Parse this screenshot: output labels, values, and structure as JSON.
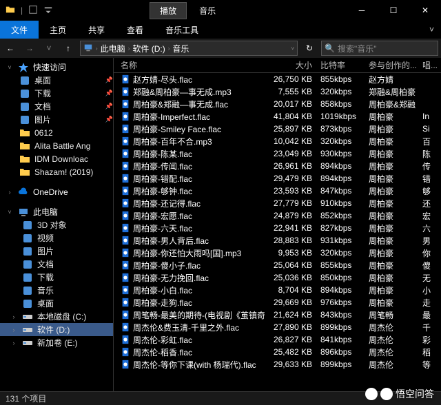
{
  "title_group": {
    "box": "播放",
    "plain": "音乐"
  },
  "ribbon": {
    "file": "文件",
    "tabs": [
      "主页",
      "共享",
      "查看",
      "音乐工具"
    ]
  },
  "breadcrumb": [
    "此电脑",
    "软件 (D:)",
    "音乐"
  ],
  "search_placeholder": "搜索\"音乐\"",
  "columns": {
    "name": "名称",
    "size": "大小",
    "bitrate": "比特率",
    "artist": "参与创作的...",
    "extra": "唱..."
  },
  "status": "131 个项目",
  "watermark": "悟空问答",
  "sidebar": {
    "quick": {
      "label": "快速访问",
      "items": [
        "桌面",
        "下载",
        "文档",
        "图片",
        "0612",
        "Alita Battle Ang",
        "IDM Downloac",
        "Shazam! (2019)"
      ]
    },
    "onedrive": "OneDrive",
    "pc": {
      "label": "此电脑",
      "items": [
        "3D 对象",
        "视频",
        "图片",
        "文档",
        "下载",
        "音乐",
        "桌面",
        "本地磁盘 (C:)",
        "软件 (D:)",
        "新加卷 (E:)"
      ]
    },
    "selected_index": 8
  },
  "files": [
    {
      "name": "赵方婧-尽头.flac",
      "size": "26,750 KB",
      "bitrate": "855kbps",
      "artist": "赵方婧",
      "extra": ""
    },
    {
      "name": "郑融&周柏豪—事无成.mp3",
      "size": "7,555 KB",
      "bitrate": "320kbps",
      "artist": "郑融&周柏豪",
      "extra": ""
    },
    {
      "name": "周柏豪&郑融—事无成.flac",
      "size": "20,017 KB",
      "bitrate": "858kbps",
      "artist": "周柏豪&郑融",
      "extra": ""
    },
    {
      "name": "周柏豪-Imperfect.flac",
      "size": "41,804 KB",
      "bitrate": "1019kbps",
      "artist": "周柏豪",
      "extra": "In"
    },
    {
      "name": "周柏豪-Smiley Face.flac",
      "size": "25,897 KB",
      "bitrate": "873kbps",
      "artist": "周柏豪",
      "extra": "Si"
    },
    {
      "name": "周柏豪-百年不合.mp3",
      "size": "10,042 KB",
      "bitrate": "320kbps",
      "artist": "周柏豪",
      "extra": "百"
    },
    {
      "name": "周柏豪-陈某.flac",
      "size": "23,049 KB",
      "bitrate": "930kbps",
      "artist": "周柏豪",
      "extra": "陈"
    },
    {
      "name": "周柏豪-传闻.flac",
      "size": "26,961 KB",
      "bitrate": "894kbps",
      "artist": "周柏豪",
      "extra": "传"
    },
    {
      "name": "周柏豪-错配.flac",
      "size": "29,479 KB",
      "bitrate": "894kbps",
      "artist": "周柏豪",
      "extra": "错"
    },
    {
      "name": "周柏豪-够钟.flac",
      "size": "23,593 KB",
      "bitrate": "847kbps",
      "artist": "周柏豪",
      "extra": "够"
    },
    {
      "name": "周柏豪-还记得.flac",
      "size": "27,779 KB",
      "bitrate": "910kbps",
      "artist": "周柏豪",
      "extra": "还"
    },
    {
      "name": "周柏豪-宏愿.flac",
      "size": "24,879 KB",
      "bitrate": "852kbps",
      "artist": "周柏豪",
      "extra": "宏"
    },
    {
      "name": "周柏豪-六天.flac",
      "size": "22,941 KB",
      "bitrate": "827kbps",
      "artist": "周柏豪",
      "extra": "六"
    },
    {
      "name": "周柏豪-男人背后.flac",
      "size": "28,883 KB",
      "bitrate": "931kbps",
      "artist": "周柏豪",
      "extra": "男"
    },
    {
      "name": "周柏豪-你还怕大雨吗[国].mp3",
      "size": "9,953 KB",
      "bitrate": "320kbps",
      "artist": "周柏豪",
      "extra": "你"
    },
    {
      "name": "周柏豪-傻小子.flac",
      "size": "25,064 KB",
      "bitrate": "855kbps",
      "artist": "周柏豪",
      "extra": "傻"
    },
    {
      "name": "周柏豪-无力挽回.flac",
      "size": "25,036 KB",
      "bitrate": "850kbps",
      "artist": "周柏豪",
      "extra": "无"
    },
    {
      "name": "周柏豪-小白.flac",
      "size": "8,704 KB",
      "bitrate": "894kbps",
      "artist": "周柏豪",
      "extra": "小"
    },
    {
      "name": "周柏豪-走狗.flac",
      "size": "29,669 KB",
      "bitrate": "976kbps",
      "artist": "周柏豪",
      "extra": "走"
    },
    {
      "name": "周笔畅-最美的期待-(电视剧《茧镇奇缘…",
      "size": "21,624 KB",
      "bitrate": "843kbps",
      "artist": "周笔畅",
      "extra": "最"
    },
    {
      "name": "周杰伦&费玉清-千里之外.flac",
      "size": "27,890 KB",
      "bitrate": "899kbps",
      "artist": "周杰伦",
      "extra": "千"
    },
    {
      "name": "周杰伦-彩虹.flac",
      "size": "26,827 KB",
      "bitrate": "841kbps",
      "artist": "周杰伦",
      "extra": "彩"
    },
    {
      "name": "周杰伦-稻香.flac",
      "size": "25,482 KB",
      "bitrate": "896kbps",
      "artist": "周杰伦",
      "extra": "稻"
    },
    {
      "name": "周杰伦-等你下课(with 杨瑞代).flac",
      "size": "29,633 KB",
      "bitrate": "899kbps",
      "artist": "周杰伦",
      "extra": "等"
    }
  ]
}
